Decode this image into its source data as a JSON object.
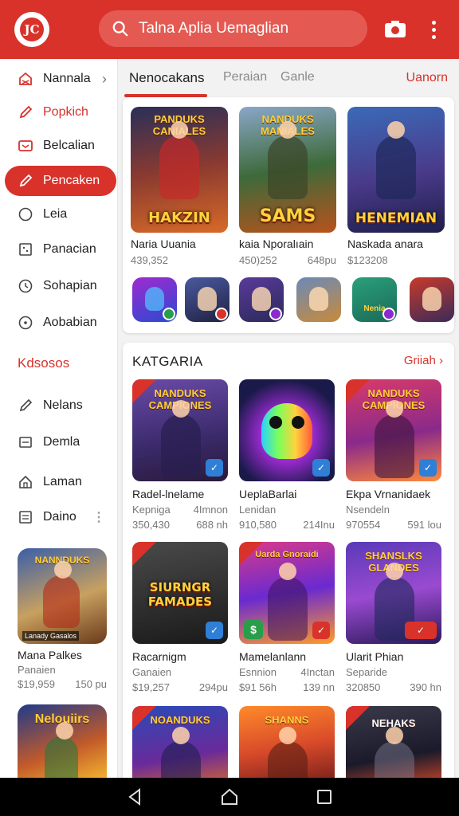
{
  "header": {
    "logo_text": "JC",
    "search_placeholder": "Talna Aplia Uemaglian",
    "icons": {
      "search": "search-icon",
      "camera": "camera-icon",
      "menu": "more-vert-icon"
    },
    "accent": "#d8322b"
  },
  "sidebar": {
    "items": [
      {
        "label": "Nannala",
        "icon": "home-icon"
      },
      {
        "label": "Popkich",
        "icon": "pencil-icon"
      },
      {
        "label": "Belcalian",
        "icon": "tv-icon"
      },
      {
        "label": "Pencaken",
        "icon": "pencil-icon"
      },
      {
        "label": "Leia",
        "icon": "circle-icon"
      },
      {
        "label": "Panacian",
        "icon": "grid-icon"
      },
      {
        "label": "Sohapian",
        "icon": "clock-icon"
      },
      {
        "label": "Aobabian",
        "icon": "compass-icon"
      }
    ],
    "section_heading": "Kdsosos",
    "section_items": [
      {
        "label": "Nelans",
        "icon": "pencil-icon"
      },
      {
        "label": "Demla",
        "icon": "message-icon"
      },
      {
        "label": "Laman",
        "icon": "house-icon"
      },
      {
        "label": "Daino",
        "icon": "document-icon"
      }
    ],
    "games": [
      {
        "art": "NANNDUKS",
        "badge": "Lanady Gasalos",
        "name": "Mana Palkes",
        "sub": "Panaien",
        "count": "$19,959",
        "size": "150 pu"
      },
      {
        "art": "Nelouiirs"
      }
    ]
  },
  "tabs": {
    "items": [
      "Nenocakans",
      "Peraian",
      "Ganle"
    ],
    "active": 0,
    "right_link": "Uanorn"
  },
  "featured": {
    "games": [
      {
        "top": "PANDUKS CANIALES",
        "art": "HAKZIN",
        "name": "Naria Uuania",
        "count": "439,352",
        "size": ""
      },
      {
        "top": "NANDUKS MANIALES",
        "art": "SAMS",
        "name": "kaia  Nporalıain",
        "count": "450)252",
        "size": "648pu"
      },
      {
        "top": "",
        "art": "HENEMIAN",
        "name": "Naskada anara",
        "count": "$123208",
        "size": ""
      }
    ],
    "icons": [
      "game-icon-1",
      "game-icon-2",
      "game-icon-3",
      "game-icon-4",
      "game-icon-5",
      "game-icon-6"
    ],
    "icon_text_5": "Nenia"
  },
  "category": {
    "title": "KATGARIA",
    "link": "Griiah",
    "games": [
      {
        "art": "NANDUKS CAMPIONES",
        "name": "Radel-lnelame",
        "sub_a": "Kepniga",
        "sub_b": "4Imnon",
        "count": "350,430",
        "size": "688 nh"
      },
      {
        "art": "",
        "name": "UeplaBarlai",
        "sub_a": "Lenidan",
        "sub_b": "",
        "count": "910,580",
        "size": "214Inu"
      },
      {
        "art": "NANDUKS CAMPIONES",
        "name": "Ekpa Vrnanidaek",
        "sub_a": "Nsendeln",
        "sub_b": "",
        "count": "970554",
        "size": "591 lou"
      },
      {
        "art": "SIURNGR FAMADES",
        "name": "Racarnigm",
        "sub_a": "Ganaien",
        "sub_b": "",
        "count": "$19,257",
        "size": "294pu"
      },
      {
        "art": "Uarda Gnoraidi",
        "name": "Mamelanlann",
        "sub_a": "Esnnion",
        "sub_b": "4Inctan",
        "count": "$91 56h",
        "size": "139 nn"
      },
      {
        "art": "SHANSLKS GLANDES",
        "name": "Ularit Phian",
        "sub_a": "Separide",
        "sub_b": "",
        "count": "320850",
        "size": "390 hn"
      },
      {
        "art": "NOANDUKS"
      },
      {
        "art": "SHANNS"
      },
      {
        "art": "NEHAKS"
      }
    ]
  },
  "navbar": {
    "icons": [
      "back-icon",
      "home-icon",
      "recents-icon"
    ]
  }
}
